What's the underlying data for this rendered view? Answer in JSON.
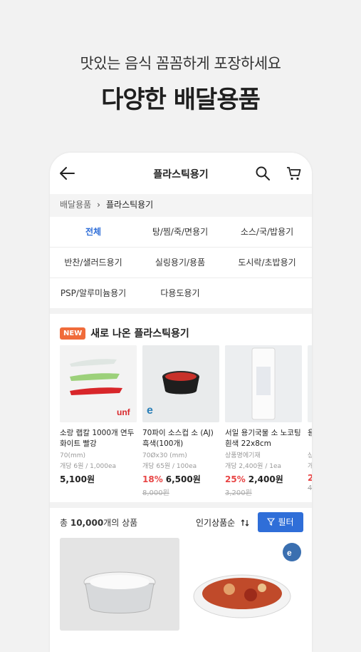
{
  "promo": {
    "subtitle": "맛있는 음식 꼼꼼하게 포장하세요",
    "headline": "다양한 배달용품"
  },
  "appbar": {
    "title": "플라스틱용기",
    "icons": [
      "back-arrow-icon",
      "search-icon",
      "cart-icon"
    ]
  },
  "breadcrumb": {
    "root": "배달용품",
    "separator": "›",
    "current": "플라스틱용기"
  },
  "categories": [
    {
      "label": "전체",
      "active": true
    },
    {
      "label": "탕/찜/죽/면용기"
    },
    {
      "label": "소스/국/밥용기"
    },
    {
      "label": "반찬/샐러드용기"
    },
    {
      "label": "실링용기/용품"
    },
    {
      "label": "도시락/초밥용기"
    },
    {
      "label": "PSP/알루미늄용기"
    },
    {
      "label": "다용도용기"
    }
  ],
  "new_section": {
    "badge": "NEW",
    "title": "새로 나온 플라스틱용기",
    "items": [
      {
        "name": "소랑 랩칼 1000개 연두 화이트 빨강",
        "spec1": "70(mm)",
        "spec2": "개당 6원 / 1,000ea",
        "discount": "",
        "price": "5,100원",
        "original": ""
      },
      {
        "name": "70파이 소스컵 소 (AJ) 흑색(100개)",
        "spec1": "70Øx30 (mm)",
        "spec2": "개당 65원 / 100ea",
        "discount": "18%",
        "price": "6,500원",
        "original": "8,000원"
      },
      {
        "name": "서일 용기국물 소 노코팅 흰색 22x8cm",
        "spec1": "상품명에기재",
        "spec2": "개당 2,400원 / 1ea",
        "discount": "25%",
        "price": "2,400원",
        "original": "3,200원"
      },
      {
        "name": "용 1",
        "spec1": "상",
        "spec2": "개",
        "discount": "2",
        "price": "",
        "original": "4"
      }
    ]
  },
  "listing": {
    "count_prefix": "총 ",
    "count_value": "10,000",
    "count_suffix": "개의 상품",
    "sort_label": "인기상품순",
    "filter_label": "필터"
  },
  "colors": {
    "accent": "#2f6ed8",
    "discount": "#e84545",
    "new_badge": "#f06b3a"
  }
}
